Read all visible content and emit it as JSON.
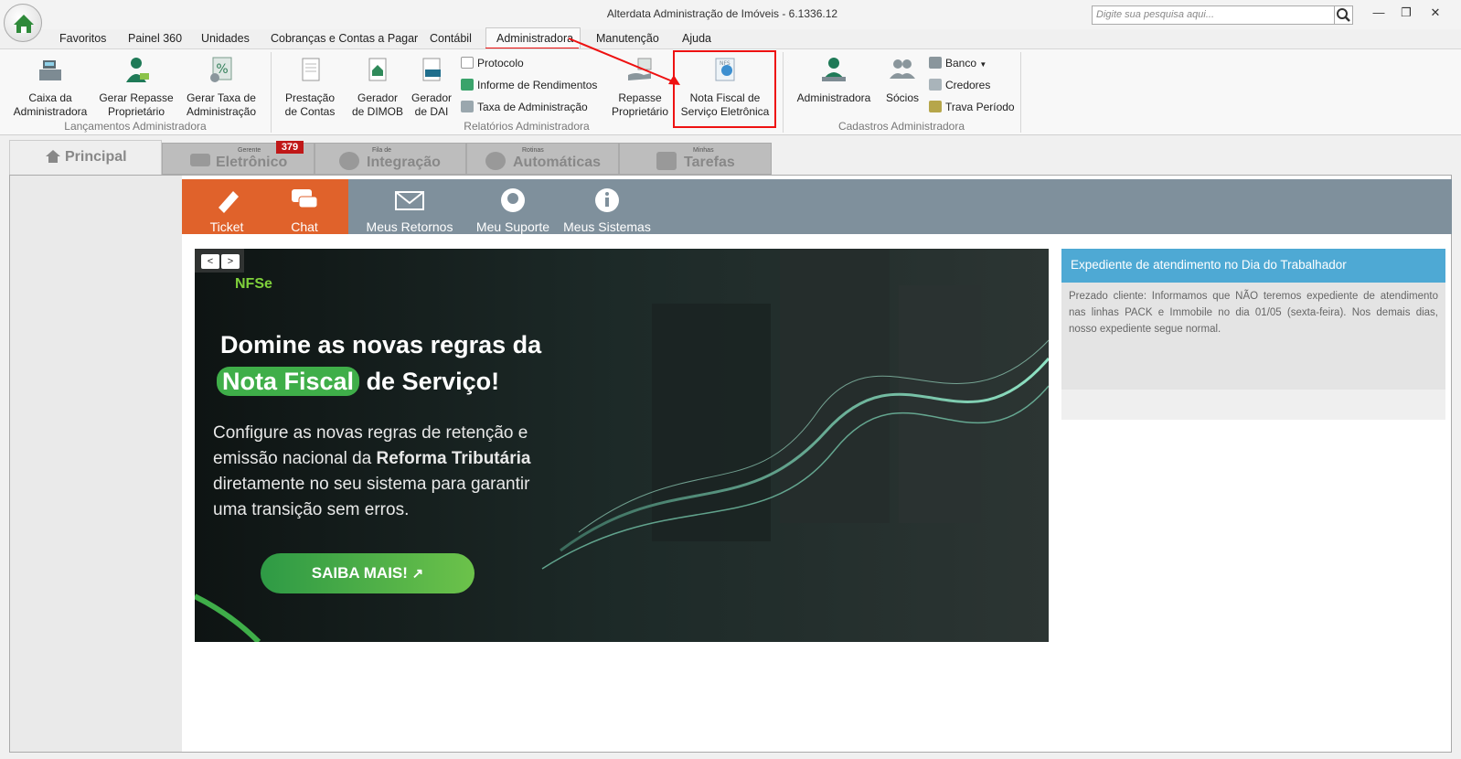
{
  "window": {
    "title": "Alterdata Administração de Imóveis - 6.1336.12",
    "search_placeholder": "Digite sua pesquisa aqui..."
  },
  "menu": [
    "Favoritos",
    "Painel 360",
    "Unidades",
    "Cobranças e Contas a Pagar",
    "Contábil",
    "Administradora",
    "Manutenção",
    "Ajuda"
  ],
  "ribbon": {
    "lanc": {
      "caixa": [
        "Caixa da",
        "Administradora"
      ],
      "repasse": [
        "Gerar Repasse",
        "Proprietário"
      ],
      "taxa": [
        "Gerar Taxa de",
        "Administração"
      ],
      "group": "Lançamentos Administradora"
    },
    "rel": {
      "prestacao": [
        "Prestação",
        "de Contas"
      ],
      "dimob": [
        "Gerador",
        "de DIMOB"
      ],
      "dai": [
        "Gerador",
        "de DAI"
      ],
      "protocolo": "Protocolo",
      "informe": "Informe de Rendimentos",
      "taxa_adm": "Taxa de Administração",
      "repasse": [
        "Repasse",
        "Proprietário"
      ],
      "nfse": [
        "Nota Fiscal de",
        "Serviço Eletrônica"
      ],
      "group": "Relatórios Administradora"
    },
    "cad": {
      "administradora": "Administradora",
      "socios": "Sócios",
      "banco": "Banco",
      "credores": "Credores",
      "trava": "Trava Período",
      "group": "Cadastros Administradora"
    }
  },
  "tabs": {
    "principal": "Principal",
    "eletronico": {
      "sub": "Gerente",
      "main": "Eletrônico",
      "badge": "379"
    },
    "integracao": {
      "sub": "Fila de",
      "main": "Integração"
    },
    "automaticas": {
      "sub": "Rotinas",
      "main": "Automáticas"
    },
    "tarefas": {
      "sub": "Minhas",
      "main": "Tarefas"
    }
  },
  "support": {
    "ticket": "Ticket",
    "chat": "Chat",
    "retornos": "Meus Retornos",
    "suporte": "Meu Suporte",
    "sistemas": "Meus Sistemas"
  },
  "banner": {
    "logo": "NFSe",
    "title1": "Domine as novas regras da",
    "title2a": "Nota Fiscal",
    "title2b": "de Serviço!",
    "body1": "Configure as novas regras de retenção e",
    "body2a": "emissão nacional da ",
    "body2b": "Reforma Tributária",
    "body3": "diretamente no seu sistema para garantir",
    "body4": "uma transição sem erros.",
    "cta": "SAIBA MAIS!"
  },
  "info": {
    "title": "Expediente de atendimento no Dia do Trabalhador",
    "body": "Prezado cliente: Informamos que NÃO teremos expediente de atendimento nas linhas PACK e Immobile no dia 01/05 (sexta-feira). Nos demais dias, nosso expediente segue normal."
  },
  "colors": {
    "accent": "#e11111",
    "orange": "#e0622b",
    "support_bar": "#7f909c",
    "info_head": "#4ea9d4",
    "cta_green": "#3fae49"
  }
}
